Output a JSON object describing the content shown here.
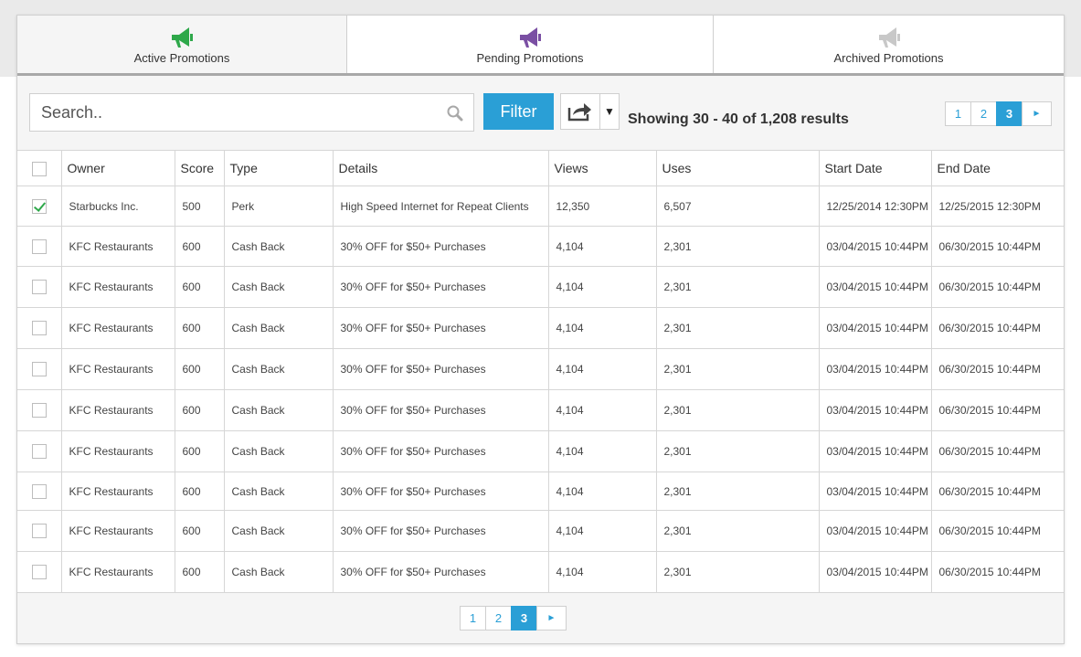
{
  "tabs": [
    {
      "label": "Active Promotions",
      "icon": "megaphone-icon",
      "icon_color": "#2ea84a",
      "active": true
    },
    {
      "label": "Pending Promotions",
      "icon": "megaphone-icon",
      "icon_color": "#7a4fa3",
      "active": false
    },
    {
      "label": "Archived Promotions",
      "icon": "megaphone-icon",
      "icon_color": "#c8c8c8",
      "active": false
    }
  ],
  "toolbar": {
    "search_placeholder": "Search..",
    "filter_label": "Filter",
    "results_text": "Showing 30 - 40 of 1,208 results"
  },
  "pagination": {
    "pages": [
      "1",
      "2",
      "3"
    ],
    "current": "3",
    "next_glyph": "►"
  },
  "table": {
    "headers": [
      "Owner",
      "Score",
      "Type",
      "Details",
      "Views",
      "Uses",
      "Start Date",
      "End Date"
    ],
    "rows": [
      {
        "checked": true,
        "owner": "Starbucks Inc.",
        "score": "500",
        "type": "Perk",
        "details": "High Speed Internet for Repeat Clients",
        "views": "12,350",
        "uses": "6,507",
        "start": "12/25/2014 12:30PM",
        "end": "12/25/2015 12:30PM"
      },
      {
        "checked": false,
        "owner": "KFC Restaurants",
        "score": "600",
        "type": "Cash Back",
        "details": "30% OFF for $50+ Purchases",
        "views": "4,104",
        "uses": "2,301",
        "start": "03/04/2015 10:44PM",
        "end": "06/30/2015 10:44PM"
      },
      {
        "checked": false,
        "owner": "KFC Restaurants",
        "score": "600",
        "type": "Cash Back",
        "details": "30% OFF for $50+ Purchases",
        "views": "4,104",
        "uses": "2,301",
        "start": "03/04/2015 10:44PM",
        "end": "06/30/2015 10:44PM"
      },
      {
        "checked": false,
        "owner": "KFC Restaurants",
        "score": "600",
        "type": "Cash Back",
        "details": "30% OFF for $50+ Purchases",
        "views": "4,104",
        "uses": "2,301",
        "start": "03/04/2015 10:44PM",
        "end": "06/30/2015 10:44PM"
      },
      {
        "checked": false,
        "owner": "KFC Restaurants",
        "score": "600",
        "type": "Cash Back",
        "details": "30% OFF for $50+ Purchases",
        "views": "4,104",
        "uses": "2,301",
        "start": "03/04/2015 10:44PM",
        "end": "06/30/2015 10:44PM"
      },
      {
        "checked": false,
        "owner": "KFC Restaurants",
        "score": "600",
        "type": "Cash Back",
        "details": "30% OFF for $50+ Purchases",
        "views": "4,104",
        "uses": "2,301",
        "start": "03/04/2015 10:44PM",
        "end": "06/30/2015 10:44PM"
      },
      {
        "checked": false,
        "owner": "KFC Restaurants",
        "score": "600",
        "type": "Cash Back",
        "details": "30% OFF for $50+ Purchases",
        "views": "4,104",
        "uses": "2,301",
        "start": "03/04/2015 10:44PM",
        "end": "06/30/2015 10:44PM"
      },
      {
        "checked": false,
        "owner": "KFC Restaurants",
        "score": "600",
        "type": "Cash Back",
        "details": "30% OFF for $50+ Purchases",
        "views": "4,104",
        "uses": "2,301",
        "start": "03/04/2015 10:44PM",
        "end": "06/30/2015 10:44PM"
      },
      {
        "checked": false,
        "owner": "KFC Restaurants",
        "score": "600",
        "type": "Cash Back",
        "details": "30% OFF for $50+ Purchases",
        "views": "4,104",
        "uses": "2,301",
        "start": "03/04/2015 10:44PM",
        "end": "06/30/2015 10:44PM"
      },
      {
        "checked": false,
        "owner": "KFC Restaurants",
        "score": "600",
        "type": "Cash Back",
        "details": "30% OFF for $50+ Purchases",
        "views": "4,104",
        "uses": "2,301",
        "start": "03/04/2015 10:44PM",
        "end": "06/30/2015 10:44PM"
      }
    ]
  },
  "colors": {
    "accent": "#2a9fd6",
    "check": "#2ea84a"
  }
}
